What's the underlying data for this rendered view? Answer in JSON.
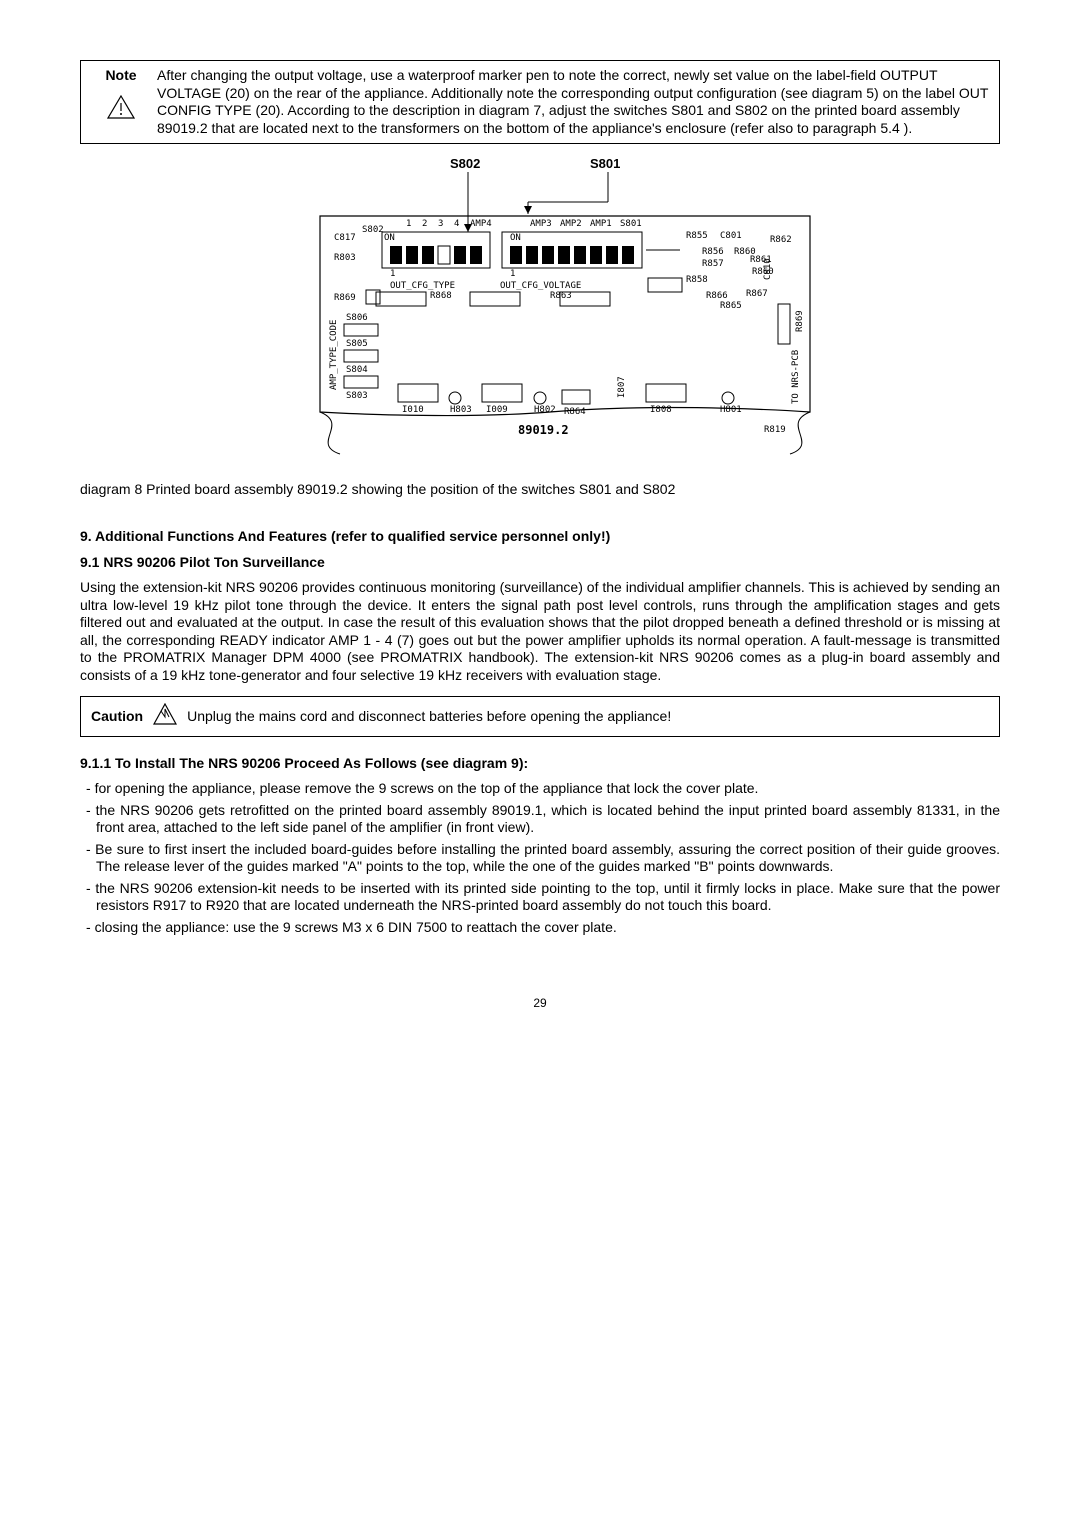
{
  "note": {
    "label": "Note",
    "text": "After changing the output voltage, use a waterproof marker pen to note the correct, newly set value on the label-field OUTPUT VOLTAGE (20) on the rear of the appliance.  Additionally note the corresponding output configuration (see diagram 5) on the label OUT CONFIG TYPE (20). According to the description in diagram 7, adjust the switches S801 and S802 on the printed board assembly 89019.2 that are located next to the transformers on the bottom of the appliance's enclosure (refer also to paragraph 5.4 )."
  },
  "diagram": {
    "s802": "S802",
    "s801": "S801",
    "digits": [
      "1",
      "2",
      "3",
      "4"
    ],
    "amp_right": [
      "AMP4",
      "",
      "AMP3",
      "AMP2",
      "AMP1",
      "S801"
    ],
    "row_left": [
      "C817",
      "S802",
      "ON",
      "R803"
    ],
    "row_right_labels": [
      "R855",
      "C801",
      "R862",
      "R856",
      "R860",
      "R861",
      "R857",
      "R860",
      "R858",
      "R866",
      "R867",
      "R865",
      "C810"
    ],
    "mid_labels": [
      "OUT_CFG_TYPE",
      "OUT_CFG_VOLTAGE",
      "R868",
      "R863"
    ],
    "left_col": [
      "R869",
      "S806",
      "S805",
      "S804",
      "S803"
    ],
    "left_col_header": "AMP_TYPE_CODE",
    "bottom_labels": [
      "I010",
      "H803",
      "I009",
      "H802",
      "R864",
      "I807",
      "I808",
      "H801"
    ],
    "r869_right": "R869",
    "to_nrs": "TO NRS-PCB",
    "board": "89019.2",
    "r819": "R819"
  },
  "caption": "diagram 8     Printed board assembly 89019.2 showing the position of the switches S801 and S802",
  "section9_heading": "9. Additional Functions And Features  (refer to qualified service personnel only!)",
  "section91_heading": "9.1 NRS 90206 Pilot Ton Surveillance",
  "section91_body": "Using the extension-kit NRS 90206 provides continuous monitoring (surveillance) of the individual amplifier channels. This is achieved by sending an ultra low-level 19 kHz pilot tone through the device. It enters the signal path post level controls, runs through the amplification stages and gets filtered out and evaluated at the output. In case the result of this evaluation shows that the pilot dropped beneath a defined threshold or is missing at all, the corresponding READY indicator AMP 1 - 4 (7) goes out but the power amplifier upholds its normal operation. A fault-message is transmitted to the PROMATRIX Manager DPM 4000 (see PROMATRIX handbook). The extension-kit NRS 90206 comes as a plug-in board assembly and consists of a 19 kHz tone-generator and four selective 19 kHz receivers with evaluation stage.",
  "caution": {
    "label": "Caution",
    "text": "Unplug the mains cord and disconnect batteries before opening the appliance!"
  },
  "section911_heading": "9.1.1 To Install The NRS 90206 Proceed As Follows (see diagram 9):",
  "install_steps": [
    "for opening the appliance, please remove the 9 screws on the top of the appliance that lock the cover plate.",
    "the NRS 90206 gets retrofitted on the printed board assembly 89019.1, which is located behind the input printed board assembly 81331, in the front area, attached to the left side panel of the amplifier (in front view).",
    "Be sure to first insert the included board-guides before installing the printed board assembly, assuring the correct position of their guide grooves. The release lever of the guides marked \"A\" points to the top, while the one of the guides marked \"B\" points downwards.",
    "the NRS 90206 extension-kit needs to be inserted with its printed side pointing to the top, until it firmly locks in place. Make sure that the power resistors R917 to R920 that are located underneath the NRS-printed board assembly do not touch this board.",
    "closing the appliance: use the 9 screws M3 x 6 DIN 7500 to reattach the cover plate."
  ],
  "page_number": "29"
}
